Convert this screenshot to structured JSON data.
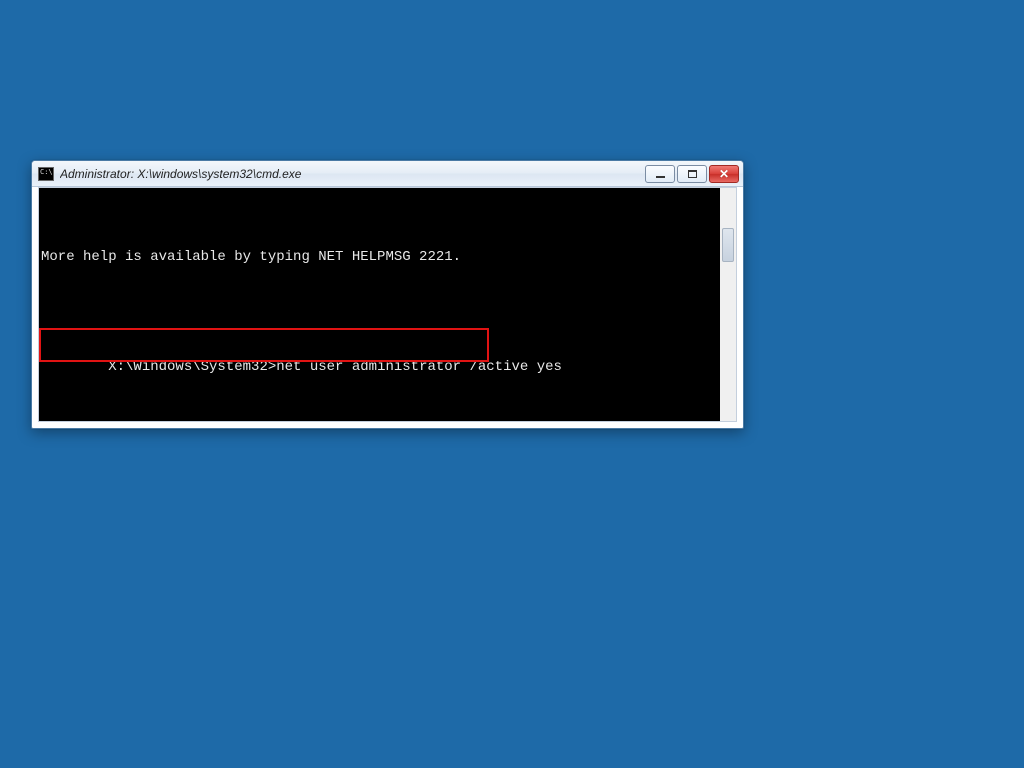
{
  "window": {
    "title": "Administrator: X:\\windows\\system32\\cmd.exe"
  },
  "terminal": {
    "help_line": "More help is available by typing NET HELPMSG 2221.",
    "prompt": "X:\\Windows\\System32>",
    "command": "net user administrator /active yes"
  }
}
